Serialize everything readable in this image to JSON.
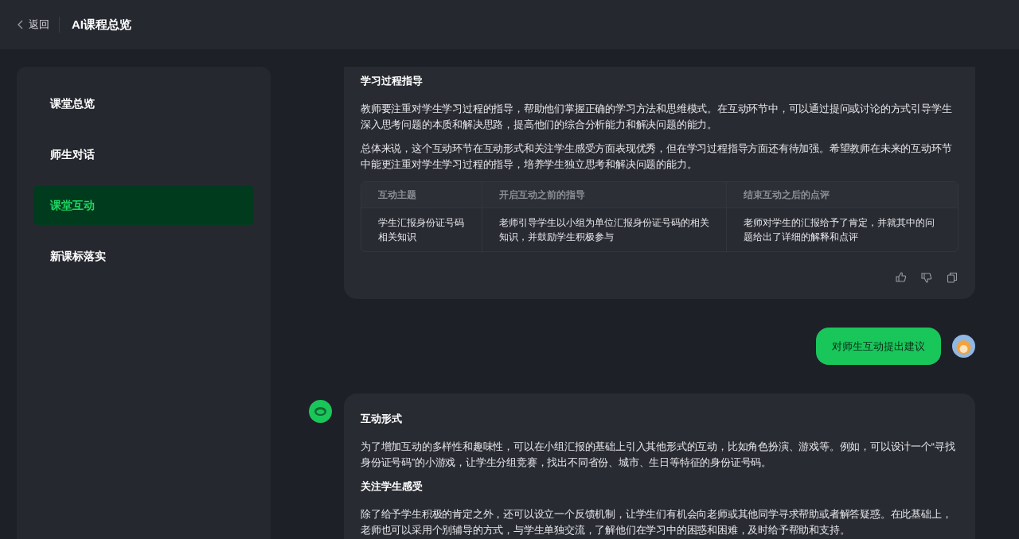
{
  "header": {
    "back_label": "返回",
    "title": "AI课程总览"
  },
  "sidebar": {
    "items": [
      {
        "label": "课堂总览",
        "selected": false
      },
      {
        "label": "师生对话",
        "selected": false
      },
      {
        "label": "课堂互动",
        "selected": true
      },
      {
        "label": "新课标落实",
        "selected": false
      }
    ]
  },
  "messages": [
    {
      "kind": "assistant",
      "show_logo": false,
      "show_actions": true,
      "blocks": [
        {
          "kind": "heading",
          "text": "学习过程指导"
        },
        {
          "kind": "paragraph",
          "text": "教师要注重对学生学习过程的指导，帮助他们掌握正确的学习方法和思维模式。在互动环节中，可以通过提问或讨论的方式引导学生深入思考问题的本质和解决思路，提高他们的综合分析能力和解决问题的能力。"
        },
        {
          "kind": "paragraph",
          "text": "总体来说，这个互动环节在互动形式和关注学生感受方面表现优秀，但在学习过程指导方面还有待加强。希望教师在未来的互动环节中能更注重对学生学习过程的指导，培养学生独立思考和解决问题的能力。"
        },
        {
          "kind": "table",
          "columns": [
            "互动主题",
            "开启互动之前的指导",
            "结束互动之后的点评"
          ],
          "rows": [
            [
              "学生汇报身份证号码相关知识",
              "老师引导学生以小组为单位汇报身份证号码的相关知识，并鼓励学生积极参与",
              "老师对学生的汇报给予了肯定，并就其中的问题给出了详细的解释和点评"
            ]
          ]
        }
      ]
    },
    {
      "kind": "user",
      "text": "对师生互动提出建议"
    },
    {
      "kind": "assistant",
      "show_logo": true,
      "show_actions": false,
      "blocks": [
        {
          "kind": "heading",
          "text": "互动形式"
        },
        {
          "kind": "paragraph",
          "text": "为了增加互动的多样性和趣味性，可以在小组汇报的基础上引入其他形式的互动，比如角色扮演、游戏等。例如，可以设计一个“寻找身份证号码”的小游戏，让学生分组竞赛，找出不同省份、城市、生日等特征的身份证号码。"
        },
        {
          "kind": "heading",
          "text": "关注学生感受"
        },
        {
          "kind": "paragraph",
          "text": "除了给予学生积极的肯定之外，还可以设立一个反馈机制，让学生们有机会向老师或其他同学寻求帮助或者解答疑惑。在此基础上，老师也可以采用个别辅导的方式，与学生单独交流，了解他们在学习中的困惑和困难，及时给予帮助和支持。"
        }
      ]
    }
  ]
}
